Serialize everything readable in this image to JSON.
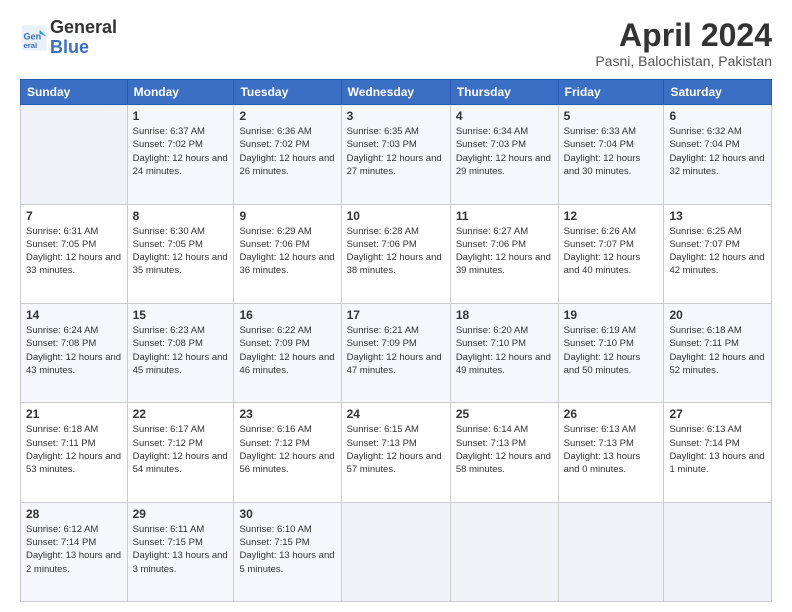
{
  "header": {
    "logo_line1": "General",
    "logo_line2": "Blue",
    "month": "April 2024",
    "location": "Pasni, Balochistan, Pakistan"
  },
  "columns": [
    "Sunday",
    "Monday",
    "Tuesday",
    "Wednesday",
    "Thursday",
    "Friday",
    "Saturday"
  ],
  "weeks": [
    [
      {
        "day": "",
        "sunrise": "",
        "sunset": "",
        "daylight": ""
      },
      {
        "day": "1",
        "sunrise": "Sunrise: 6:37 AM",
        "sunset": "Sunset: 7:02 PM",
        "daylight": "Daylight: 12 hours and 24 minutes."
      },
      {
        "day": "2",
        "sunrise": "Sunrise: 6:36 AM",
        "sunset": "Sunset: 7:02 PM",
        "daylight": "Daylight: 12 hours and 26 minutes."
      },
      {
        "day": "3",
        "sunrise": "Sunrise: 6:35 AM",
        "sunset": "Sunset: 7:03 PM",
        "daylight": "Daylight: 12 hours and 27 minutes."
      },
      {
        "day": "4",
        "sunrise": "Sunrise: 6:34 AM",
        "sunset": "Sunset: 7:03 PM",
        "daylight": "Daylight: 12 hours and 29 minutes."
      },
      {
        "day": "5",
        "sunrise": "Sunrise: 6:33 AM",
        "sunset": "Sunset: 7:04 PM",
        "daylight": "Daylight: 12 hours and 30 minutes."
      },
      {
        "day": "6",
        "sunrise": "Sunrise: 6:32 AM",
        "sunset": "Sunset: 7:04 PM",
        "daylight": "Daylight: 12 hours and 32 minutes."
      }
    ],
    [
      {
        "day": "7",
        "sunrise": "Sunrise: 6:31 AM",
        "sunset": "Sunset: 7:05 PM",
        "daylight": "Daylight: 12 hours and 33 minutes."
      },
      {
        "day": "8",
        "sunrise": "Sunrise: 6:30 AM",
        "sunset": "Sunset: 7:05 PM",
        "daylight": "Daylight: 12 hours and 35 minutes."
      },
      {
        "day": "9",
        "sunrise": "Sunrise: 6:29 AM",
        "sunset": "Sunset: 7:06 PM",
        "daylight": "Daylight: 12 hours and 36 minutes."
      },
      {
        "day": "10",
        "sunrise": "Sunrise: 6:28 AM",
        "sunset": "Sunset: 7:06 PM",
        "daylight": "Daylight: 12 hours and 38 minutes."
      },
      {
        "day": "11",
        "sunrise": "Sunrise: 6:27 AM",
        "sunset": "Sunset: 7:06 PM",
        "daylight": "Daylight: 12 hours and 39 minutes."
      },
      {
        "day": "12",
        "sunrise": "Sunrise: 6:26 AM",
        "sunset": "Sunset: 7:07 PM",
        "daylight": "Daylight: 12 hours and 40 minutes."
      },
      {
        "day": "13",
        "sunrise": "Sunrise: 6:25 AM",
        "sunset": "Sunset: 7:07 PM",
        "daylight": "Daylight: 12 hours and 42 minutes."
      }
    ],
    [
      {
        "day": "14",
        "sunrise": "Sunrise: 6:24 AM",
        "sunset": "Sunset: 7:08 PM",
        "daylight": "Daylight: 12 hours and 43 minutes."
      },
      {
        "day": "15",
        "sunrise": "Sunrise: 6:23 AM",
        "sunset": "Sunset: 7:08 PM",
        "daylight": "Daylight: 12 hours and 45 minutes."
      },
      {
        "day": "16",
        "sunrise": "Sunrise: 6:22 AM",
        "sunset": "Sunset: 7:09 PM",
        "daylight": "Daylight: 12 hours and 46 minutes."
      },
      {
        "day": "17",
        "sunrise": "Sunrise: 6:21 AM",
        "sunset": "Sunset: 7:09 PM",
        "daylight": "Daylight: 12 hours and 47 minutes."
      },
      {
        "day": "18",
        "sunrise": "Sunrise: 6:20 AM",
        "sunset": "Sunset: 7:10 PM",
        "daylight": "Daylight: 12 hours and 49 minutes."
      },
      {
        "day": "19",
        "sunrise": "Sunrise: 6:19 AM",
        "sunset": "Sunset: 7:10 PM",
        "daylight": "Daylight: 12 hours and 50 minutes."
      },
      {
        "day": "20",
        "sunrise": "Sunrise: 6:18 AM",
        "sunset": "Sunset: 7:11 PM",
        "daylight": "Daylight: 12 hours and 52 minutes."
      }
    ],
    [
      {
        "day": "21",
        "sunrise": "Sunrise: 6:18 AM",
        "sunset": "Sunset: 7:11 PM",
        "daylight": "Daylight: 12 hours and 53 minutes."
      },
      {
        "day": "22",
        "sunrise": "Sunrise: 6:17 AM",
        "sunset": "Sunset: 7:12 PM",
        "daylight": "Daylight: 12 hours and 54 minutes."
      },
      {
        "day": "23",
        "sunrise": "Sunrise: 6:16 AM",
        "sunset": "Sunset: 7:12 PM",
        "daylight": "Daylight: 12 hours and 56 minutes."
      },
      {
        "day": "24",
        "sunrise": "Sunrise: 6:15 AM",
        "sunset": "Sunset: 7:13 PM",
        "daylight": "Daylight: 12 hours and 57 minutes."
      },
      {
        "day": "25",
        "sunrise": "Sunrise: 6:14 AM",
        "sunset": "Sunset: 7:13 PM",
        "daylight": "Daylight: 12 hours and 58 minutes."
      },
      {
        "day": "26",
        "sunrise": "Sunrise: 6:13 AM",
        "sunset": "Sunset: 7:13 PM",
        "daylight": "Daylight: 13 hours and 0 minutes."
      },
      {
        "day": "27",
        "sunrise": "Sunrise: 6:13 AM",
        "sunset": "Sunset: 7:14 PM",
        "daylight": "Daylight: 13 hours and 1 minute."
      }
    ],
    [
      {
        "day": "28",
        "sunrise": "Sunrise: 6:12 AM",
        "sunset": "Sunset: 7:14 PM",
        "daylight": "Daylight: 13 hours and 2 minutes."
      },
      {
        "day": "29",
        "sunrise": "Sunrise: 6:11 AM",
        "sunset": "Sunset: 7:15 PM",
        "daylight": "Daylight: 13 hours and 3 minutes."
      },
      {
        "day": "30",
        "sunrise": "Sunrise: 6:10 AM",
        "sunset": "Sunset: 7:15 PM",
        "daylight": "Daylight: 13 hours and 5 minutes."
      },
      {
        "day": "",
        "sunrise": "",
        "sunset": "",
        "daylight": ""
      },
      {
        "day": "",
        "sunrise": "",
        "sunset": "",
        "daylight": ""
      },
      {
        "day": "",
        "sunrise": "",
        "sunset": "",
        "daylight": ""
      },
      {
        "day": "",
        "sunrise": "",
        "sunset": "",
        "daylight": ""
      }
    ]
  ]
}
